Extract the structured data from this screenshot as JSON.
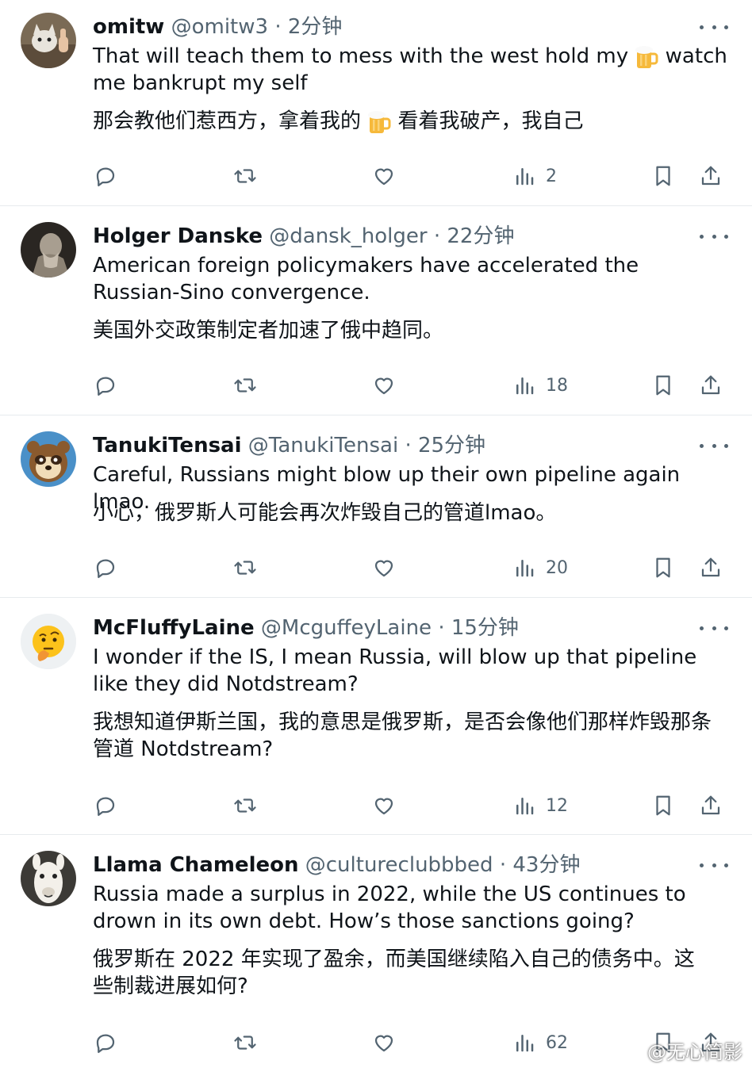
{
  "tweets": [
    {
      "name": "omitw",
      "handle": "@omitw3",
      "time": "2分钟",
      "text_before": "That will teach them to mess with the west hold my",
      "text_after": "watch me bankrupt my self",
      "trans_before": "那会教他们惹西方，拿着我的",
      "trans_after": "看着我破产，我自己",
      "emoji": "beer-mug-emoji",
      "views": "2",
      "avatar": "cat-thumbs-up-avatar"
    },
    {
      "name": "Holger Danske",
      "handle": "@dansk_holger",
      "time": "22分钟",
      "text": "American foreign policymakers have accelerated the Russian-Sino convergence.",
      "trans": "美国外交政策制定者加速了俄中趋同。",
      "views": "18",
      "avatar": "statue-avatar"
    },
    {
      "name": "TanukiTensai",
      "handle": "@TanukiTensai",
      "time": "25分钟",
      "text": "Careful, Russians might blow up their own pipeline again lmao.",
      "trans": "小心，俄罗斯人可能会再次炸毁自己的管道lmao。",
      "views": "20",
      "avatar": "tanuki-avatar"
    },
    {
      "name": "McFluffyLaine",
      "handle": "@McguffeyLaine",
      "time": "15分钟",
      "text": "I wonder if the IS, I mean Russia, will blow up that pipeline like they did Notdstream?",
      "trans": "我想知道伊斯兰国，我的意思是俄罗斯，是否会像他们那样炸毁那条管道 Notdstream?",
      "views": "12",
      "avatar": "thinking-face-avatar"
    },
    {
      "name": "Llama Chameleon",
      "handle": "@cultureclubbbed",
      "time": "43分钟",
      "text": "Russia made a surplus in 2022, while the US continues to drown in its own debt. How’s those sanctions going?",
      "trans": "俄罗斯在 2022 年实现了盈余，而美国继续陷入自己的债务中。这些制裁进展如何?",
      "views": "62",
      "avatar": "llama-avatar"
    }
  ],
  "separator": "·",
  "watermark": "@无心简影",
  "colors": {
    "text": "#0f1419",
    "muted": "#536471",
    "divider": "#e7ebee"
  }
}
